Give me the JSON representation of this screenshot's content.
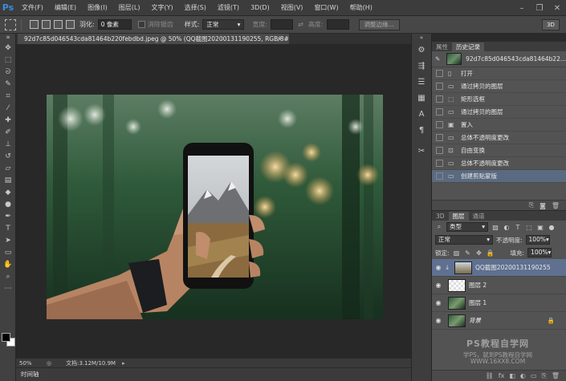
{
  "app": {
    "logo": "Ps"
  },
  "menu": {
    "items": [
      "文件(F)",
      "编辑(E)",
      "图像(I)",
      "图层(L)",
      "文字(Y)",
      "选择(S)",
      "滤镜(T)",
      "3D(D)",
      "视图(V)",
      "窗口(W)",
      "帮助(H)"
    ]
  },
  "options": {
    "feather_label": "羽化:",
    "feather_value": "0 像素",
    "antialias_label": "消除锯齿",
    "style_label": "样式:",
    "style_value": "正常",
    "width_label": "宽度:",
    "height_label": "高度:",
    "refine_edge": "调整边缘...",
    "workspace": "3D"
  },
  "document": {
    "tab_title": "92d7c85d046543cda81464b220febdbd.jpeg @ 50% (QQ截图20200131190255, RGB/8#) *",
    "close": "×"
  },
  "status": {
    "zoom": "50%",
    "doc_size": "文档:3.12M/10.9M"
  },
  "timeline": {
    "label": "时间轴"
  },
  "history": {
    "tabs": [
      "属性",
      "历史记录"
    ],
    "snapshot": "92d7c85d046543cda81464b22...",
    "items": [
      {
        "label": "打开",
        "icon": "document-icon"
      },
      {
        "label": "通过拷贝的图层",
        "icon": "layer-icon"
      },
      {
        "label": "矩形选框",
        "icon": "marquee-icon"
      },
      {
        "label": "通过拷贝的图层",
        "icon": "layer-icon"
      },
      {
        "label": "置入",
        "icon": "place-icon"
      },
      {
        "label": "总体不透明度更改",
        "icon": "layer-icon"
      },
      {
        "label": "自由变换",
        "icon": "transform-icon"
      },
      {
        "label": "总体不透明度更改",
        "icon": "layer-icon"
      },
      {
        "label": "创建剪贴蒙版",
        "icon": "layer-icon"
      }
    ]
  },
  "layers": {
    "tabs": [
      "3D",
      "图层",
      "通道"
    ],
    "filter_kind": "类型",
    "blend_mode": "正常",
    "opacity_label": "不透明度:",
    "opacity_value": "100%",
    "lock_label": "锁定:",
    "fill_label": "填充:",
    "fill_value": "100%",
    "list": [
      {
        "name": "QQ截图20200131190255",
        "active": true
      },
      {
        "name": "图层 2",
        "active": false
      },
      {
        "name": "图层 1",
        "active": false
      },
      {
        "name": "背景",
        "active": false
      }
    ]
  },
  "watermark": {
    "line1": "PS教程自学网",
    "line2": "学PS，就到PS教程自学网",
    "line3": "WWW.16XX8.COM"
  }
}
